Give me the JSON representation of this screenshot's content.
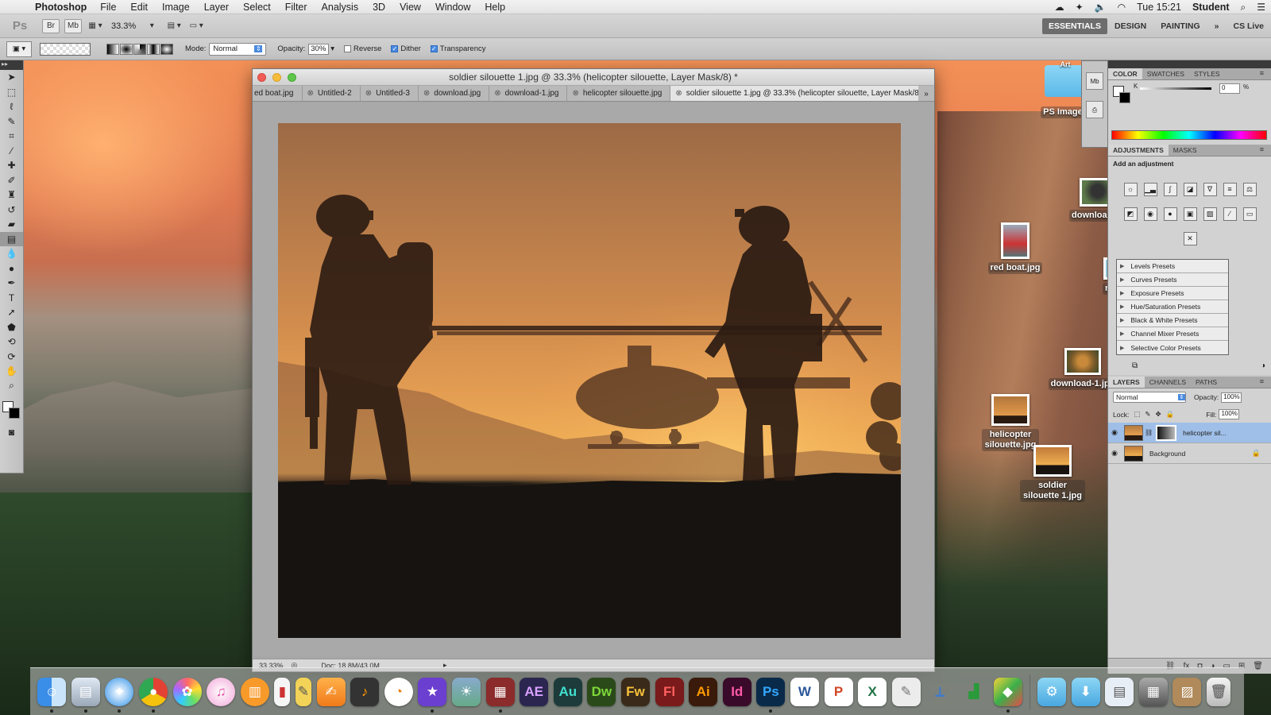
{
  "menubar": {
    "app_name": "Photoshop",
    "menus": [
      "File",
      "Edit",
      "Image",
      "Layer",
      "Select",
      "Filter",
      "Analysis",
      "3D",
      "View",
      "Window",
      "Help"
    ],
    "clock": "Tue 15:21",
    "user": "Student"
  },
  "appbar": {
    "logo": "Ps",
    "br_label": "Br",
    "mb_label": "Mb",
    "zoom": "33.3%",
    "workspaces": [
      "ESSENTIALS",
      "DESIGN",
      "PAINTING"
    ],
    "overflow": "»",
    "cs_live": "CS Live"
  },
  "options": {
    "mode_label": "Mode:",
    "mode_value": "Normal",
    "opacity_label": "Opacity:",
    "opacity_value": "30%",
    "reverse_label": "Reverse",
    "dither_label": "Dither",
    "transparency_label": "Transparency"
  },
  "document": {
    "title": "soldier silouette 1.jpg @ 33.3% (helicopter silouette, Layer Mask/8) *",
    "tabs": [
      {
        "label": "ed boat.jpg"
      },
      {
        "label": "Untitled-2"
      },
      {
        "label": "Untitled-3"
      },
      {
        "label": "download.jpg"
      },
      {
        "label": "download-1.jpg"
      },
      {
        "label": "helicopter silouette.jpg"
      },
      {
        "label": "soldier silouette 1.jpg @ 33.3% (helicopter silouette, Layer Mask/8) *"
      }
    ],
    "status_zoom": "33.33%",
    "status_docsize": "Doc: 18.8M/43.0M"
  },
  "desktop_icons": {
    "ps_images": "PS Images",
    "art_label": "Art",
    "download": "download.jpg",
    "red_boat": "red boat.jpg",
    "download1": "download-1.jpg",
    "helicopter": "helicopter silouette.jpg",
    "soldier": "soldier silouette 1.jpg",
    "map": "map-"
  },
  "panels": {
    "color_tabs": [
      "COLOR",
      "SWATCHES",
      "STYLES"
    ],
    "k_label": "K",
    "k_value": "0",
    "k_unit": "%",
    "adj_tabs": [
      "ADJUSTMENTS",
      "MASKS"
    ],
    "adj_hint": "Add an adjustment",
    "presets": [
      "Levels Presets",
      "Curves Presets",
      "Exposure Presets",
      "Hue/Saturation Presets",
      "Black & White Presets",
      "Channel Mixer Presets",
      "Selective Color Presets"
    ],
    "layer_tabs": [
      "LAYERS",
      "CHANNELS",
      "PATHS"
    ],
    "blend_mode": "Normal",
    "opacity_label": "Opacity:",
    "opacity_value": "100%",
    "lock_label": "Lock:",
    "fill_label": "Fill:",
    "fill_value": "100%",
    "layers": [
      {
        "name": "helicopter sil..."
      },
      {
        "name": "Background"
      }
    ]
  },
  "dock": {
    "apps": [
      "Finder",
      "Preview",
      "Safari",
      "Chrome",
      "Photos",
      "iTunes",
      "iBooks",
      "Calendar",
      "Notes",
      "Pages",
      "GarageBand",
      "Blender",
      "iMovie",
      "iPhoto",
      "FileMerge",
      "AE",
      "Au",
      "Dw",
      "Fw",
      "Fl",
      "Ai",
      "Id",
      "Ps",
      "W",
      "P",
      "X",
      "Script",
      "Keynote",
      "Numbers",
      "Maps",
      "Applications",
      "Downloads",
      "Documents",
      "Photos2",
      "Texture",
      "Trash"
    ]
  }
}
